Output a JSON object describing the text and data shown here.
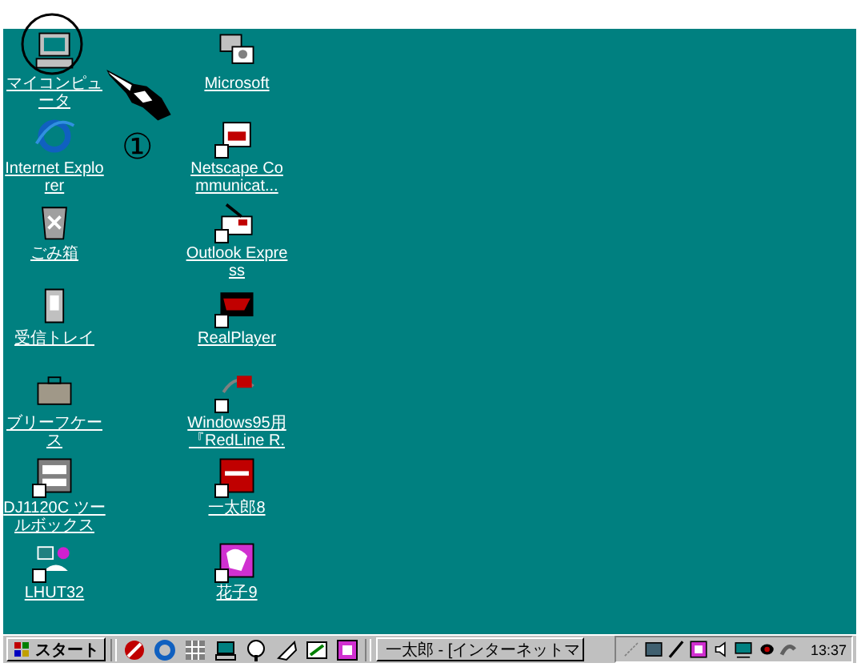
{
  "desktop": {
    "icons": [
      {
        "label": "マイコンピュータ",
        "kind": "computer",
        "shortcut": false
      },
      {
        "label": "Microsoft",
        "kind": "network",
        "shortcut": false
      },
      {
        "label": "Internet Explorer",
        "kind": "ie",
        "shortcut": false
      },
      {
        "label": "Netscape Communicat...",
        "kind": "netscape",
        "shortcut": true
      },
      {
        "label": "ごみ箱",
        "kind": "recycle",
        "shortcut": false
      },
      {
        "label": "Outlook Express",
        "kind": "outlook",
        "shortcut": true
      },
      {
        "label": "受信トレイ",
        "kind": "inbox",
        "shortcut": false
      },
      {
        "label": "RealPlayer",
        "kind": "realplayer",
        "shortcut": true
      },
      {
        "label": "ブリーフケース",
        "kind": "briefcase",
        "shortcut": false
      },
      {
        "label": "Windows95用『RedLine R.",
        "kind": "redline",
        "shortcut": true
      },
      {
        "label": "DJ1120C ツールボックス",
        "kind": "printer",
        "shortcut": true
      },
      {
        "label": "一太郎8",
        "kind": "ichitaro",
        "shortcut": true
      },
      {
        "label": "LHUT32",
        "kind": "lhut",
        "shortcut": true
      },
      {
        "label": "花子9",
        "kind": "hanako",
        "shortcut": true
      }
    ]
  },
  "annotation": {
    "marker": "①"
  },
  "taskbar": {
    "start": "スタート",
    "quick_launch": [
      {
        "kind": "explorer"
      },
      {
        "kind": "ie"
      },
      {
        "kind": "grid"
      },
      {
        "kind": "desktop"
      },
      {
        "kind": "help"
      },
      {
        "kind": "tools"
      },
      {
        "kind": "mail"
      },
      {
        "kind": "app"
      }
    ],
    "tasks": [
      {
        "label": "一太郎 - [インターネットマ",
        "selected": false
      }
    ],
    "tray": [
      {
        "kind": "connection"
      },
      {
        "kind": "monitor"
      },
      {
        "kind": "pen"
      },
      {
        "kind": "app"
      },
      {
        "kind": "speaker"
      },
      {
        "kind": "network"
      },
      {
        "kind": "mouse"
      },
      {
        "kind": "display"
      }
    ],
    "clock": "13:37"
  }
}
